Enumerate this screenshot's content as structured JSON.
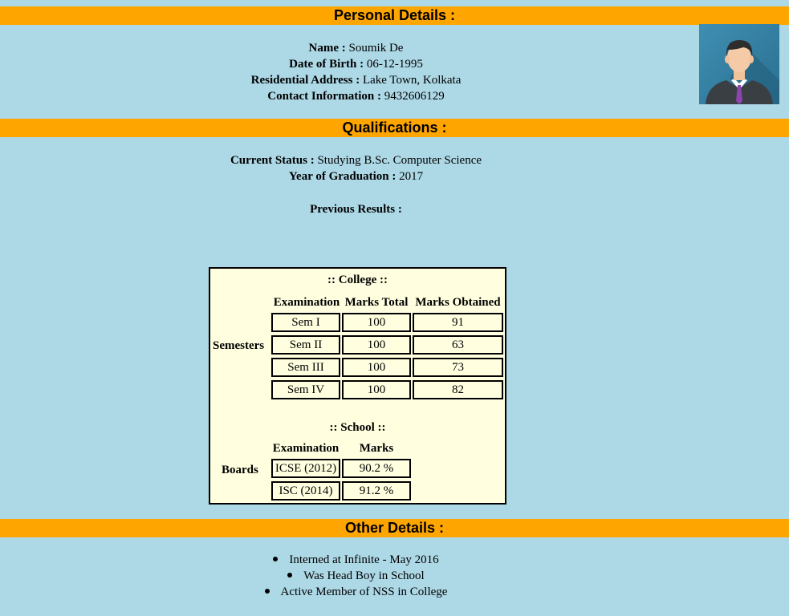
{
  "personal": {
    "heading": "Personal Details :",
    "name_label": "Name :",
    "name_value": "Soumik De",
    "dob_label": "Date of Birth :",
    "dob_value": "06-12-1995",
    "address_label": "Residential Address :",
    "address_value": "Lake Town, Kolkata",
    "contact_label": "Contact Information :",
    "contact_value": "9432606129",
    "avatar_icon": "person-avatar-icon"
  },
  "qualifications": {
    "heading": "Qualifications :",
    "status_label": "Current Status :",
    "status_value": "Studying B.Sc. Computer Science",
    "grad_label": "Year of Graduation :",
    "grad_value": "2017",
    "prev_label": "Previous Results :"
  },
  "college": {
    "caption": ":: College ::",
    "row_label": "Semesters",
    "headers": [
      "Examination",
      "Marks Total",
      "Marks Obtained"
    ],
    "rows": [
      [
        "Sem I",
        "100",
        "91"
      ],
      [
        "Sem II",
        "100",
        "63"
      ],
      [
        "Sem III",
        "100",
        "73"
      ],
      [
        "Sem IV",
        "100",
        "82"
      ]
    ]
  },
  "school": {
    "caption": ":: School ::",
    "row_label": "Boards",
    "headers": [
      "Examination",
      "Marks"
    ],
    "rows": [
      [
        "ICSE (2012)",
        "90.2 %"
      ],
      [
        "ISC (2014)",
        "91.2 %"
      ]
    ]
  },
  "other": {
    "heading": "Other Details :",
    "items": [
      "Interned at Infinite - May 2016",
      "Was Head Boy in School",
      "Active Member of NSS in College"
    ]
  },
  "colors": {
    "band": "#ffa500",
    "background": "#add8e6",
    "table_bg": "#ffffe0"
  }
}
